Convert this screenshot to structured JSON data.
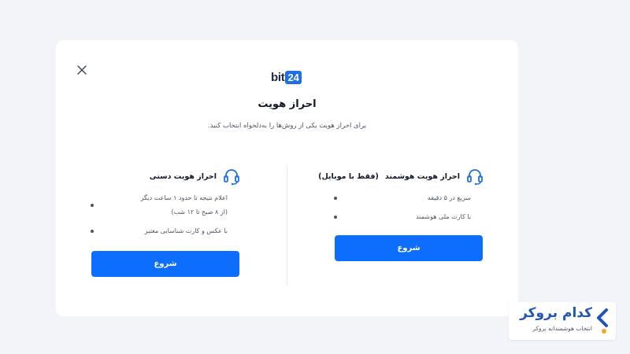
{
  "dialog": {
    "logo_text": "bit",
    "logo_badge": "24",
    "title": "احراز هویت",
    "subtitle": "برای احراز هویت یکی از روش‌ها را به‌دلخواه انتخاب کنید."
  },
  "options": {
    "smart": {
      "title": "احراز هویت هوشمند",
      "tag": "(فقط با موبایل)",
      "features": [
        "سریع در ۵ دقیقه",
        "با کارت ملی هوشمند"
      ],
      "button_label": "شروع"
    },
    "manual": {
      "title": "احراز هویت دستی",
      "features": [
        {
          "line1": "اعلام نتیجه تا حدود ۱ ساعت دیگر",
          "line2": "(از ۸ صبح تا ۱۲ شب)"
        },
        {
          "line1": "با عکس و کارت شناسایی معتبر",
          "line2": ""
        }
      ],
      "button_label": "شروع"
    }
  },
  "watermark": {
    "title": "کدام بروکر",
    "subtitle": "انتخاب هوشمندانه بروکر"
  },
  "colors": {
    "primary_button": "#0d6efd",
    "icon_blue": "#1e6fe6",
    "background": "#f2f4f7",
    "watermark_blue": "#1f56b8",
    "watermark_orange": "#f5a623"
  },
  "icons": {
    "close": "close-icon",
    "smart_option": "headset-icon",
    "manual_option": "headset-icon"
  }
}
